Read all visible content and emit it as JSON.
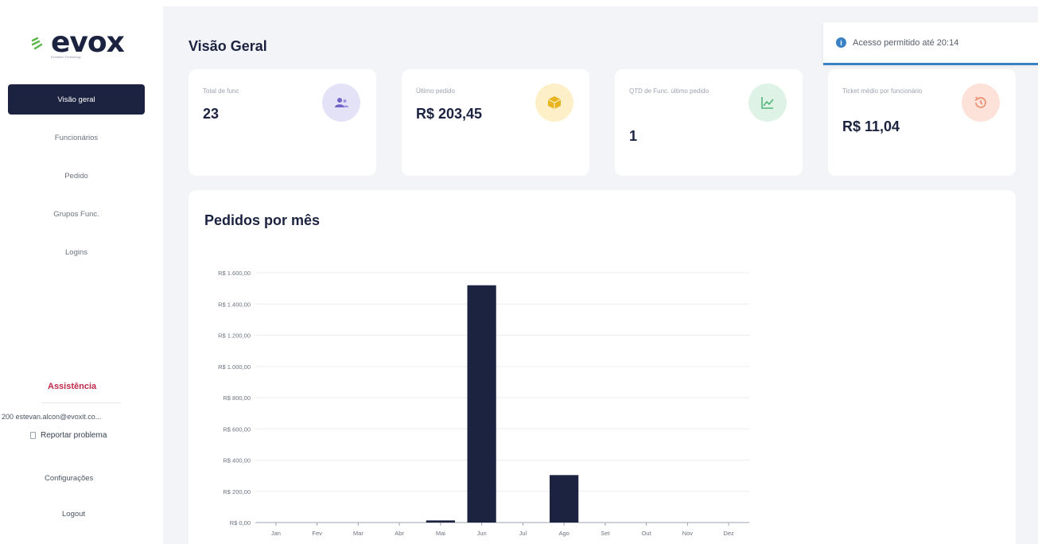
{
  "brand": {
    "name": "evox",
    "tagline": "Evolution Technology",
    "accent": "#1c2340",
    "logo_mark_color": "#5bb54a"
  },
  "sidebar": {
    "items": [
      {
        "label": "Visão geral",
        "active": true
      },
      {
        "label": "Funcionários",
        "active": false
      },
      {
        "label": "Pedido",
        "active": false
      },
      {
        "label": "Grupos Func.",
        "active": false
      },
      {
        "label": "Logins",
        "active": false
      }
    ],
    "assist_label": "Assistência",
    "user_email": "200 estevan.alcon@evoxit.co...",
    "report_label": "Reportar problema",
    "config_label": "Configurações",
    "logout_label": "Logout"
  },
  "header": {
    "title": "Visão Geral"
  },
  "toast": {
    "text": "Acesso permitido até 20:14",
    "icon": "info-icon",
    "color": "#3b82c4"
  },
  "cards": [
    {
      "label": "Total de func",
      "value": "23",
      "icon": "users-icon",
      "icon_bg": "#e4e2f7",
      "icon_color": "#6e64c9"
    },
    {
      "label": "Último pedido",
      "value": "R$ 203,45",
      "icon": "box-icon",
      "icon_bg": "#fdf0c8",
      "icon_color": "#e8b51f"
    },
    {
      "label": "QTD de Func. último pedido",
      "value": "1",
      "icon": "chart-line-icon",
      "icon_bg": "#def3e5",
      "icon_color": "#54b47a"
    },
    {
      "label": "Ticket médio por funcionário",
      "value": "R$ 11,04",
      "icon": "history-icon",
      "icon_bg": "#fde2d9",
      "icon_color": "#ee8a6c"
    }
  ],
  "chart_section": {
    "title": "Pedidos por mês"
  },
  "chart_data": {
    "type": "bar",
    "categories": [
      "Jan",
      "Fev",
      "Mar",
      "Abr",
      "Mai",
      "Jun",
      "Jul",
      "Ago",
      "Set",
      "Out",
      "Nov",
      "Dez"
    ],
    "values": [
      0,
      0,
      0,
      0,
      13.5,
      1520,
      0,
      304,
      0,
      0,
      0,
      0
    ],
    "ylim": [
      0,
      1600
    ],
    "yticks": [
      0,
      200,
      400,
      600,
      800,
      1000,
      1200,
      1400,
      1600
    ],
    "ytick_labels": [
      "R$ 0,00",
      "R$ 200,00",
      "R$ 400,00",
      "R$ 600,00",
      "R$ 800,00",
      "R$ 1.000,00",
      "R$ 1.200,00",
      "R$ 1.400,00",
      "R$ 1.600,00"
    ],
    "bar_color": "#1c2340",
    "grid": true
  }
}
